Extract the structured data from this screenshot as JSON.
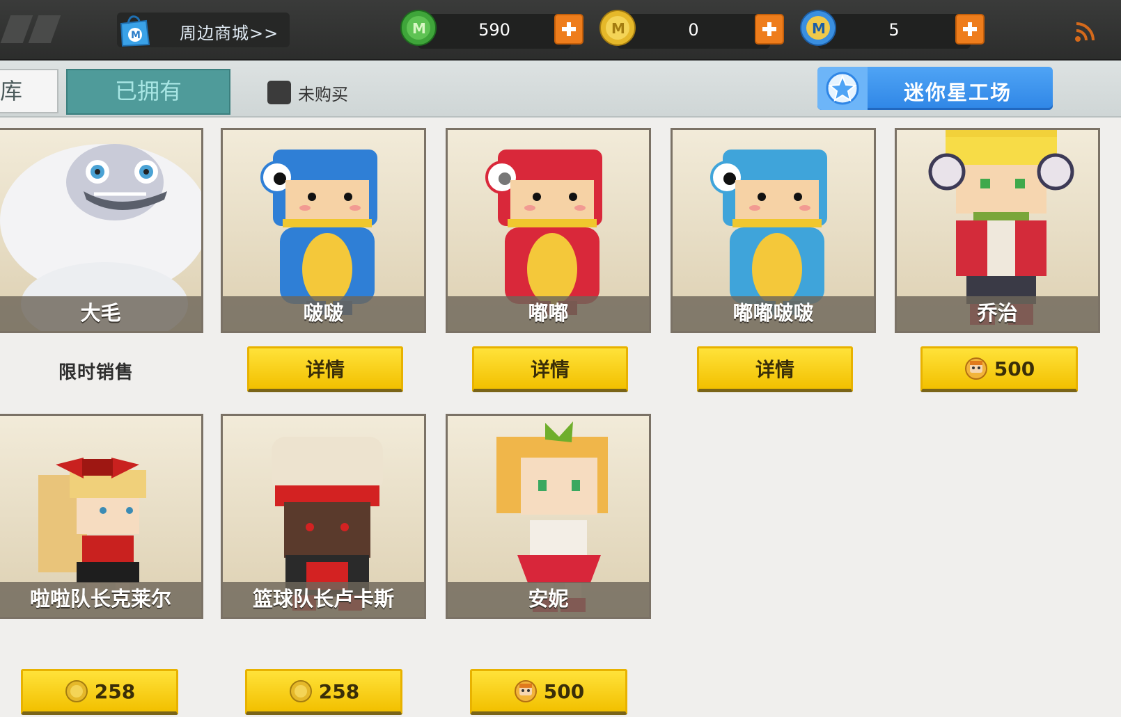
{
  "topbar": {
    "shop_label": "周边商城>>",
    "currencies": [
      {
        "name": "mini-bean",
        "value": "590",
        "color": "#3fa53a"
      },
      {
        "name": "mini-coin",
        "value": "0",
        "color": "#e5b82a"
      },
      {
        "name": "mini-point",
        "value": "5",
        "color": "#3a8fe0"
      }
    ]
  },
  "tabs": {
    "warehouse_partial": "库",
    "owned": "已拥有",
    "unpurchased_label": "未购买",
    "workshop_label": "迷你星工场"
  },
  "row1": {
    "promo_text": "限时销售",
    "cards": [
      {
        "name": "大毛"
      },
      {
        "name": "啵啵",
        "button": "详情"
      },
      {
        "name": "嘟嘟",
        "button": "详情"
      },
      {
        "name": "嘟嘟啵啵",
        "button": "详情"
      },
      {
        "name": "乔治",
        "price": "500",
        "price_icon": "avatar-coin-icon"
      }
    ]
  },
  "row2": {
    "cards": [
      {
        "name": "啦啦队长克莱尔",
        "price": "258",
        "price_icon": "mini-coin-icon"
      },
      {
        "name": "篮球队长卢卡斯",
        "price": "258",
        "price_icon": "mini-coin-icon"
      },
      {
        "name": "安妮",
        "price": "500",
        "price_icon": "avatar-coin-icon"
      }
    ]
  },
  "colors": {
    "accent_teal": "#4f9b9a",
    "button_yellow": "#ffe23a",
    "workshop_blue": "#2f86e6",
    "plus_orange": "#ee7d1c"
  }
}
